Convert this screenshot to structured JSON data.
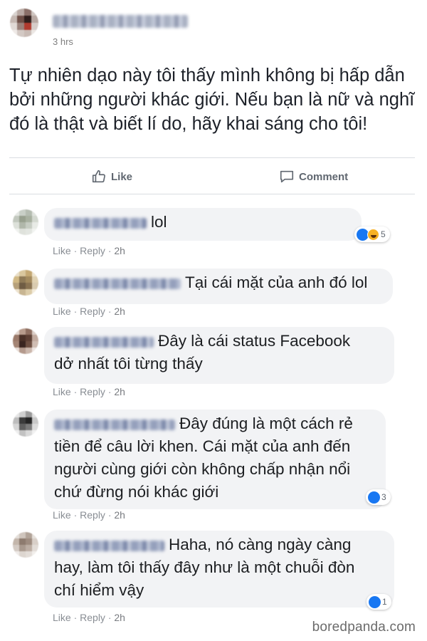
{
  "post": {
    "time": "3 hrs",
    "text": "Tự nhiên dạo này tôi thấy mình không bị hấp dẫn bởi những người khác giới. Nếu bạn là nữ và nghĩ đó là thật và biết lí do, hãy khai sáng cho tôi!"
  },
  "actions": {
    "like_label": "Like",
    "comment_label": "Comment"
  },
  "comment_actions": {
    "like": "Like",
    "reply": "Reply"
  },
  "comments": [
    {
      "text": "lol",
      "time": "2h",
      "reaction_count": "5"
    },
    {
      "text": "Tại cái mặt của anh đó lol",
      "time": "2h"
    },
    {
      "text": "Đây là cái status Facebook",
      "text2": "dở nhất tôi từng thấy",
      "time": "2h"
    },
    {
      "text": "Đây đúng là một cách rẻ",
      "text2": "tiền để câu lời khen. Cái mặt của anh đến",
      "text3": "người cùng giới còn không chấp nhận nổi",
      "text4": "chứ đừng nói khác giới",
      "time": "2h",
      "reaction_count": "3"
    },
    {
      "text": "Haha, nó càng ngày càng",
      "text2": "hay, làm tôi thấy đây như là một chuỗi đòn",
      "text3": "chí hiểm vậy",
      "time": "2h",
      "reaction_count": "1"
    }
  ],
  "watermark": "boredpanda.com",
  "colors": {
    "accent": "#1877f2",
    "bubble": "#f2f3f5",
    "meta": "#90949c"
  },
  "icons": {
    "like": "thumbs-up-icon",
    "comment": "speech-bubble-icon"
  }
}
